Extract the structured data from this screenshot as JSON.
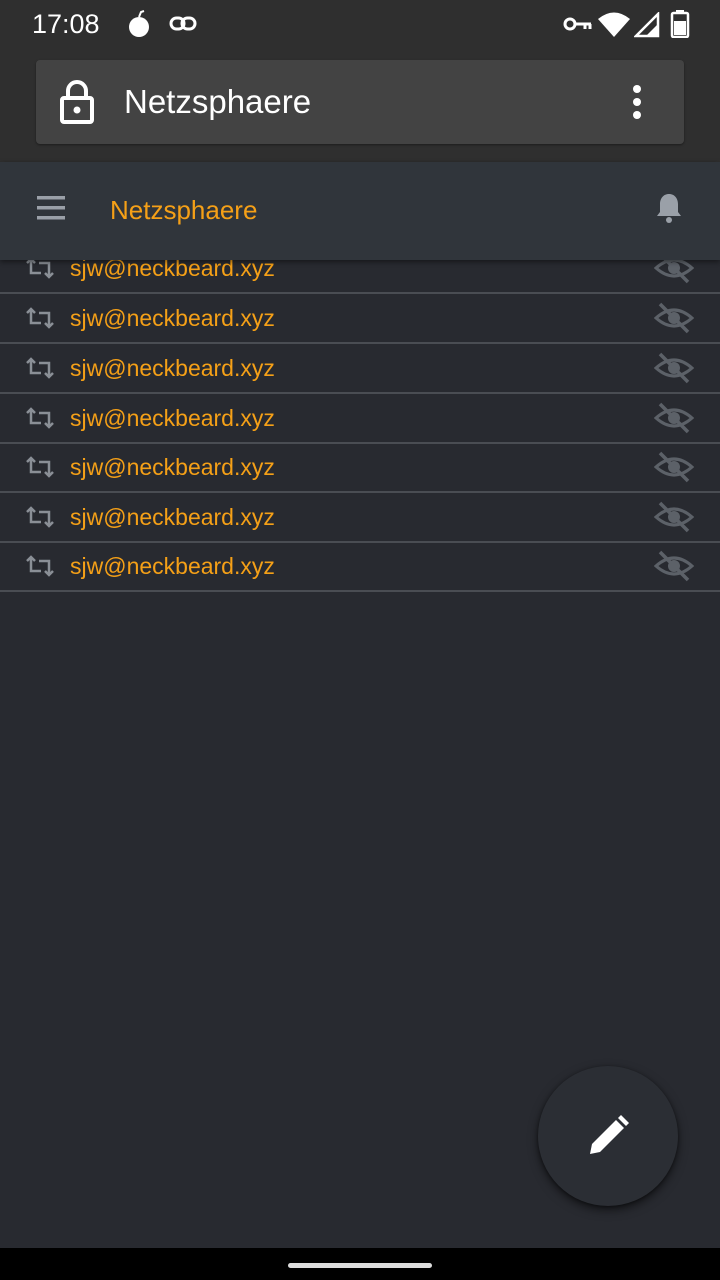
{
  "status_bar": {
    "time": "17:08",
    "icons": [
      "bomb-icon",
      "link-icon",
      "vpn-key-icon",
      "wifi-icon",
      "signal-icon",
      "battery-icon"
    ]
  },
  "browser": {
    "url_title": "Netzsphaere",
    "icons": [
      "lock-icon",
      "more-vert-icon"
    ]
  },
  "app_header": {
    "title": "Netzsphaere",
    "icons": [
      "menu-icon",
      "bell-icon"
    ]
  },
  "colors": {
    "accent": "#f5a017",
    "background": "#282a30",
    "header": "#30353b"
  },
  "rows": [
    {
      "label": "sjw@neckbeard.xyz"
    },
    {
      "label": "sjw@neckbeard.xyz"
    },
    {
      "label": "sjw@neckbeard.xyz"
    },
    {
      "label": "sjw@neckbeard.xyz"
    },
    {
      "label": "sjw@neckbeard.xyz"
    },
    {
      "label": "sjw@neckbeard.xyz"
    },
    {
      "label": "sjw@neckbeard.xyz"
    }
  ],
  "row_icons": [
    "boost-icon",
    "eye-slash-icon"
  ],
  "fab": {
    "icon": "pencil-icon"
  }
}
